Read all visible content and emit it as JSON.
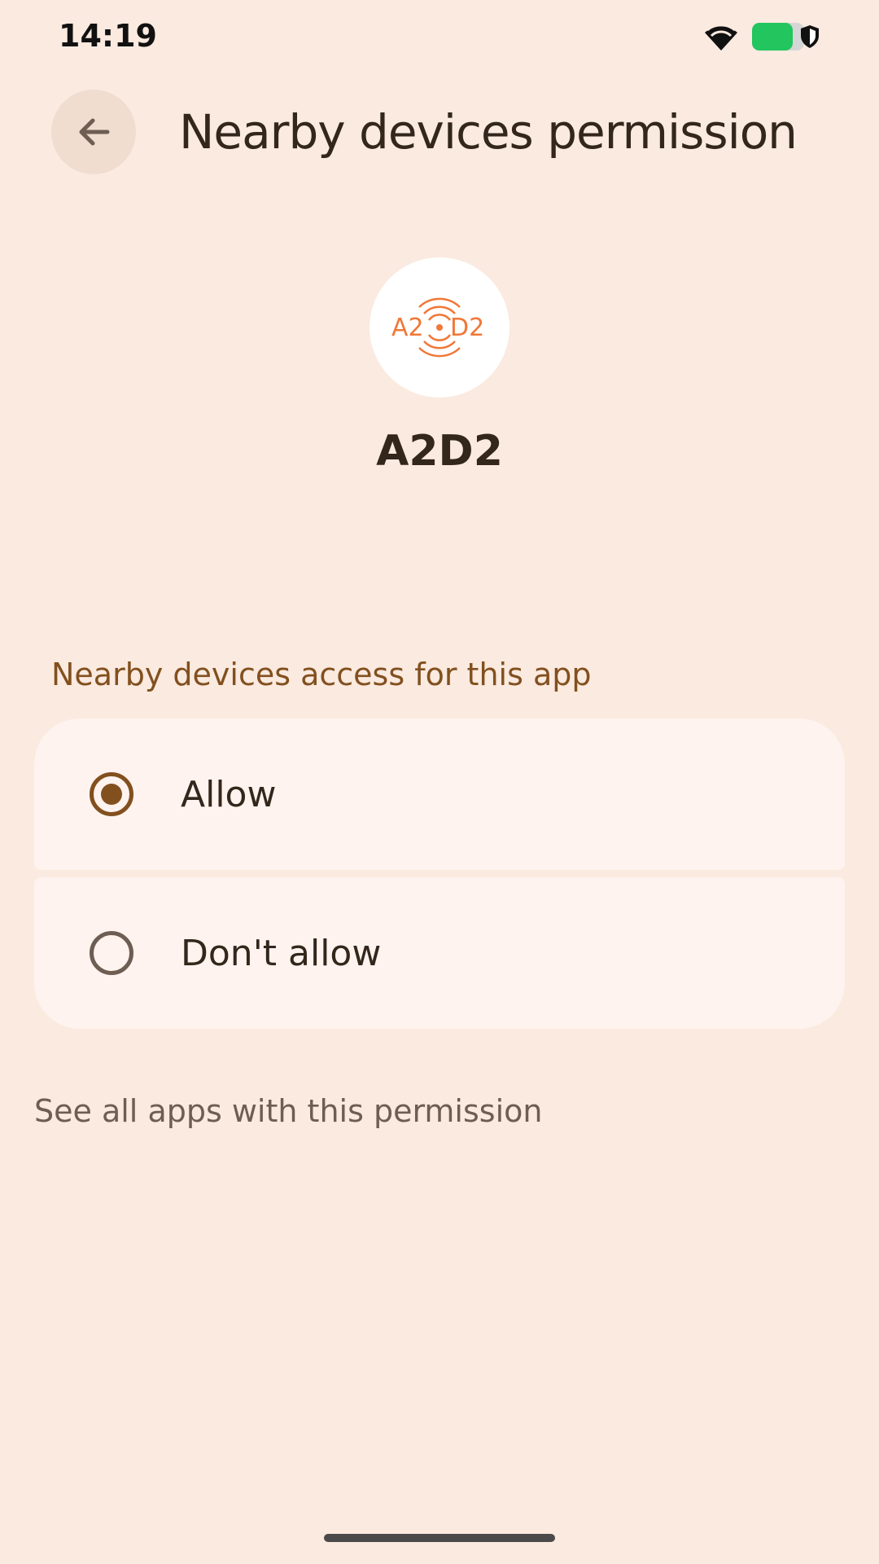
{
  "status_bar": {
    "time": "14:19",
    "icons": [
      "wifi-icon",
      "battery-icon",
      "shield-icon"
    ],
    "battery_color": "#22c55e"
  },
  "app_bar": {
    "back_icon": "arrow-left-icon",
    "title": "Nearby devices permission"
  },
  "app": {
    "icon": "a2d2-logo-icon",
    "logo_text_left": "A2",
    "logo_text_right": "D2",
    "name": "A2D2"
  },
  "section": {
    "header": "Nearby devices access for this app"
  },
  "options": [
    {
      "label": "Allow",
      "selected": true
    },
    {
      "label": "Don't allow",
      "selected": false
    }
  ],
  "link": {
    "label": "See all apps with this permission"
  },
  "colors": {
    "background": "#faeae0",
    "accent": "#82501e",
    "card": "#fff3ef",
    "logo_orange": "#f07838"
  }
}
